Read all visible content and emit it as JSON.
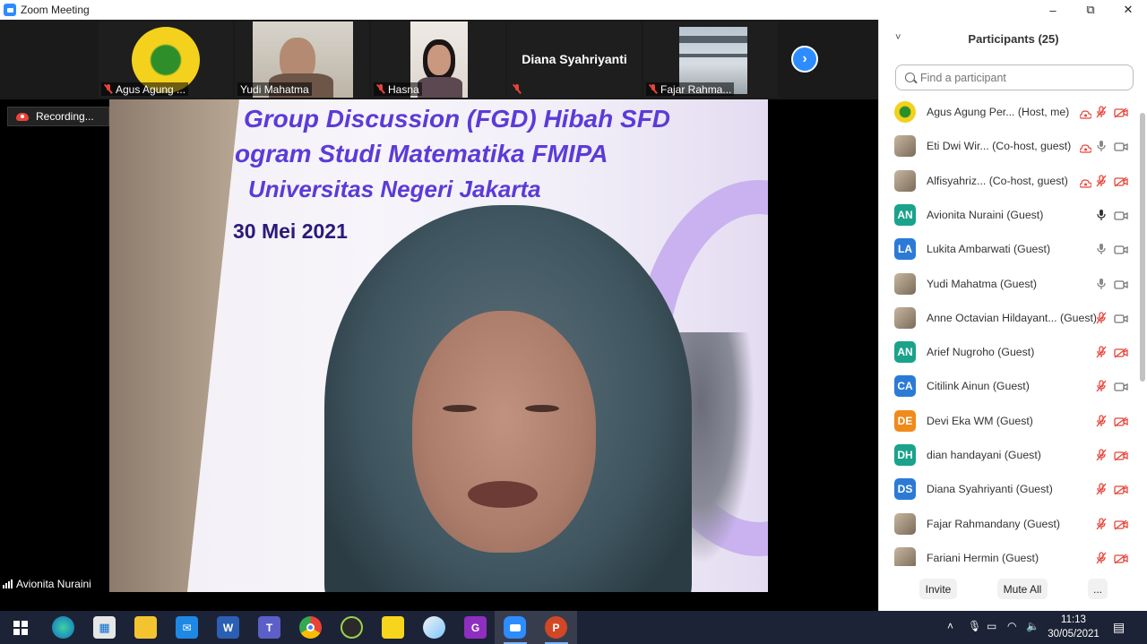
{
  "window": {
    "title": "Zoom Meeting",
    "minimize": "–",
    "restore": "⧉",
    "close": "✕"
  },
  "thumbnails": [
    {
      "name": "Agus Agung ...",
      "muted": true
    },
    {
      "name": "Yudi Mahatma",
      "muted": false
    },
    {
      "name": "Hasna",
      "muted": true
    },
    {
      "name": "Diana Syahriyanti",
      "muted": true,
      "name_only": true
    },
    {
      "name": "Fajar Rahma...",
      "muted": true
    }
  ],
  "next_page": "›",
  "recording": "Recording...",
  "slide": {
    "line1": "Group Discussion (FGD) Hibah SFD",
    "line2": "ogram Studi Matematika FMIPA",
    "line3": "Universitas Negeri Jakarta",
    "line4": "30 Mei 2021"
  },
  "active_speaker": "Avionita Nuraini",
  "participants_panel": {
    "title": "Participants (25)",
    "collapse": "˅",
    "search_placeholder": "Find a participant",
    "participants": [
      {
        "name": "Agus Agung Per...  (Host, me)",
        "initials": "",
        "avatar": "logo",
        "color": "",
        "mic": "off",
        "cam": "off",
        "rec": true
      },
      {
        "name": "Eti Dwi Wir...   (Co-host, guest)",
        "initials": "",
        "avatar": "photo",
        "color": "",
        "mic": "on",
        "cam": "on",
        "rec": true
      },
      {
        "name": "Alfisyahriz...   (Co-host, guest)",
        "initials": "",
        "avatar": "photo",
        "color": "",
        "mic": "off",
        "cam": "off",
        "rec": true
      },
      {
        "name": "Avionita Nuraini (Guest)",
        "initials": "AN",
        "avatar": "initials",
        "color": "#1aa38a",
        "mic": "on-dark",
        "cam": "on",
        "rec": false
      },
      {
        "name": "Lukita Ambarwati (Guest)",
        "initials": "LA",
        "avatar": "initials",
        "color": "#2b7bd6",
        "mic": "on",
        "cam": "on",
        "rec": false
      },
      {
        "name": "Yudi Mahatma (Guest)",
        "initials": "",
        "avatar": "photo",
        "color": "",
        "mic": "on",
        "cam": "on",
        "rec": false
      },
      {
        "name": "Anne Octavian Hildayant... (Guest)",
        "initials": "",
        "avatar": "photo",
        "color": "",
        "mic": "off",
        "cam": "on",
        "rec": false
      },
      {
        "name": "Arief Nugroho (Guest)",
        "initials": "AN",
        "avatar": "initials",
        "color": "#1aa38a",
        "mic": "off",
        "cam": "off",
        "rec": false
      },
      {
        "name": "Citilink Ainun (Guest)",
        "initials": "CA",
        "avatar": "initials",
        "color": "#2b7bd6",
        "mic": "off",
        "cam": "on",
        "rec": false
      },
      {
        "name": "Devi Eka WM (Guest)",
        "initials": "DE",
        "avatar": "initials",
        "color": "#f08a1c",
        "mic": "off",
        "cam": "off",
        "rec": false
      },
      {
        "name": "dian handayani (Guest)",
        "initials": "DH",
        "avatar": "initials",
        "color": "#1aa38a",
        "mic": "off",
        "cam": "off",
        "rec": false
      },
      {
        "name": "Diana Syahriyanti (Guest)",
        "initials": "DS",
        "avatar": "initials",
        "color": "#2b7bd6",
        "mic": "off",
        "cam": "off",
        "rec": false
      },
      {
        "name": "Fajar Rahmandany (Guest)",
        "initials": "",
        "avatar": "photo",
        "color": "",
        "mic": "off",
        "cam": "off",
        "rec": false
      },
      {
        "name": "Fariani Hermin (Guest)",
        "initials": "",
        "avatar": "photo",
        "color": "",
        "mic": "off",
        "cam": "off",
        "rec": false
      }
    ],
    "footer": {
      "invite": "Invite",
      "mute_all": "Mute All",
      "more": "..."
    }
  },
  "taskbar": {
    "clock_time": "11:13",
    "clock_date": "30/05/2021",
    "apps": [
      "windows-start",
      "edge",
      "store",
      "file-explorer",
      "mail",
      "word",
      "teams",
      "chrome",
      "xbox",
      "sticky-notes",
      "paint",
      "greenshot",
      "zoom",
      "powerpoint"
    ],
    "tray_chevron": "˄"
  },
  "colors": {
    "accent": "#2d8cff",
    "muted_red": "#e8443a",
    "slide_purple": "#5b3bd8",
    "taskbar": "#1d2336"
  }
}
